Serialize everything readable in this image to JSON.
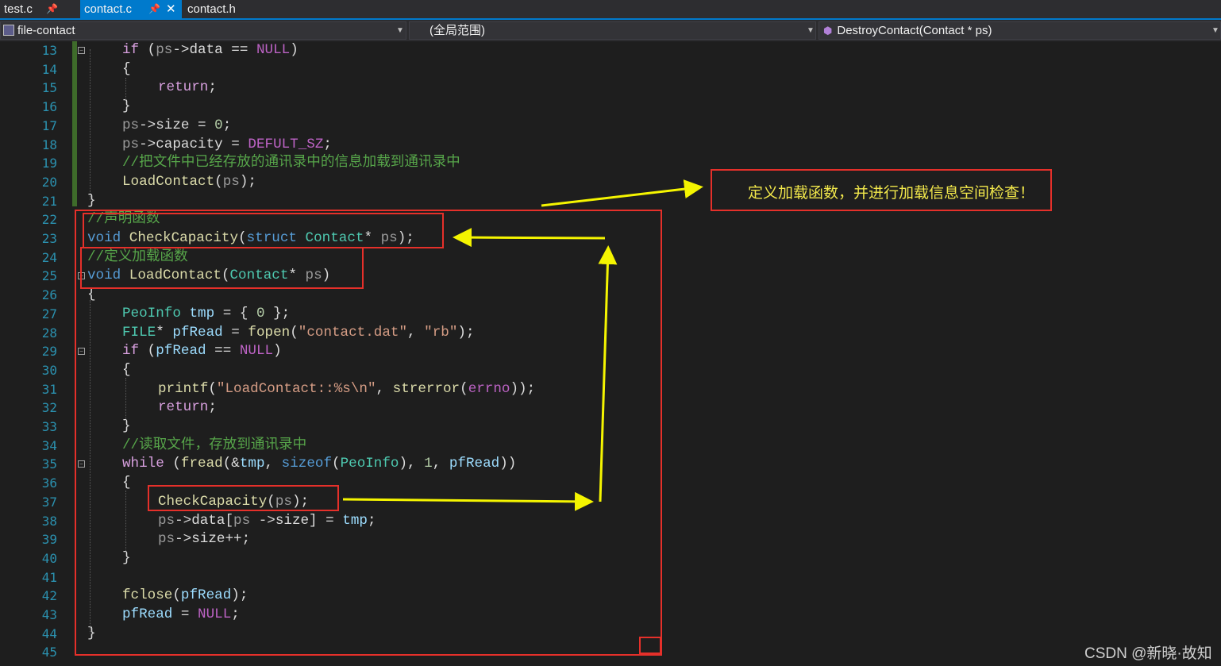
{
  "tabs": [
    {
      "label": "test.c",
      "pin": "pin-icon"
    },
    {
      "label": "contact.c",
      "pin": "pin-icon",
      "close": "close-icon",
      "active": true
    },
    {
      "label": "contact.h"
    }
  ],
  "nav": {
    "project": "file-contact",
    "scope": "(全局范围)",
    "member": "DestroyContact(Contact * ps)"
  },
  "code_lines": [
    {
      "n": "13"
    },
    {
      "n": "14"
    },
    {
      "n": "15"
    },
    {
      "n": "16"
    },
    {
      "n": "17"
    },
    {
      "n": "18"
    },
    {
      "n": "19"
    },
    {
      "n": "20"
    },
    {
      "n": "21"
    },
    {
      "n": "22"
    },
    {
      "n": "23"
    },
    {
      "n": "24"
    },
    {
      "n": "25"
    },
    {
      "n": "26"
    },
    {
      "n": "27"
    },
    {
      "n": "28"
    },
    {
      "n": "29"
    },
    {
      "n": "30"
    },
    {
      "n": "31"
    },
    {
      "n": "32"
    },
    {
      "n": "33"
    },
    {
      "n": "34"
    },
    {
      "n": "35"
    },
    {
      "n": "36"
    },
    {
      "n": "37"
    },
    {
      "n": "38"
    },
    {
      "n": "39"
    },
    {
      "n": "40"
    },
    {
      "n": "41"
    },
    {
      "n": "42"
    },
    {
      "n": "43"
    },
    {
      "n": "44"
    },
    {
      "n": "45"
    }
  ],
  "code": {
    "l13": {
      "if": "if",
      "a": " (",
      "ps": "ps",
      "b": "->data == ",
      "null": "NULL",
      "c": ")"
    },
    "l14": "{",
    "l15": {
      "ret": "return",
      "semi": ";"
    },
    "l16": "}",
    "l17": {
      "ps": "ps",
      "a": "->size = ",
      "num": "0",
      "b": ";"
    },
    "l18": {
      "ps": "ps",
      "a": "->capacity = ",
      "mac": "DEFULT_SZ",
      "b": ";"
    },
    "l19": "//把文件中已经存放的通讯录中的信息加载到通讯录中",
    "l20": {
      "fn": "LoadContact",
      "a": "(",
      "ps": "ps",
      "b": ");"
    },
    "l21": "}",
    "l22": "//声明函数",
    "l23": {
      "void": "void",
      "fn": "CheckCapacity",
      "a": "(",
      "struct": "struct",
      "ty": "Contact",
      "b": "* ",
      "ps": "ps",
      "c": ");"
    },
    "l24": "//定义加载函数",
    "l25": {
      "void": "void",
      "fn": "LoadContact",
      "a": "(",
      "ty": "Contact",
      "b": "* ",
      "ps": "ps",
      "c": ")"
    },
    "l26": "{",
    "l27": {
      "ty": "PeoInfo",
      "var": "tmp",
      "a": " = { ",
      "num": "0",
      "b": " };"
    },
    "l28": {
      "ty": "FILE",
      "a": "* ",
      "var": "pfRead",
      "b": " = ",
      "fn": "fopen",
      "c": "(",
      "s1": "\"contact.dat\"",
      "d": ", ",
      "s2": "\"rb\"",
      "e": ");"
    },
    "l29": {
      "if": "if",
      "a": " (",
      "var": "pfRead",
      "b": " == ",
      "null": "NULL",
      "c": ")"
    },
    "l30": "{",
    "l31": {
      "fn": "printf",
      "a": "(",
      "s1": "\"LoadContact::%s\\n\"",
      "b": ", ",
      "fn2": "strerror",
      "c": "(",
      "mac": "errno",
      "d": "));"
    },
    "l32": {
      "ret": "return",
      "semi": ";"
    },
    "l33": "}",
    "l34": "//读取文件，存放到通讯录中",
    "l35": {
      "while": "while",
      "a": " (",
      "fn": "fread",
      "b": "(&",
      "var": "tmp",
      "c": ", ",
      "kw": "sizeof",
      "d": "(",
      "ty": "PeoInfo",
      "e": "), ",
      "num": "1",
      "f": ", ",
      "var2": "pfRead",
      "g": "))"
    },
    "l36": "{",
    "l37": {
      "fn": "CheckCapacity",
      "a": "(",
      "ps": "ps",
      "b": ");"
    },
    "l38": {
      "ps": "ps",
      "a": "->data[",
      "ps2": "ps",
      "b": " ->size] = ",
      "var": "tmp",
      "c": ";"
    },
    "l39": {
      "ps": "ps",
      "a": "->size++;"
    },
    "l40": "}",
    "l41": "",
    "l42": {
      "fn": "fclose",
      "a": "(",
      "var": "pfRead",
      "b": ");"
    },
    "l43": {
      "var": "pfRead",
      "a": " = ",
      "null": "NULL",
      "b": ";"
    },
    "l44": "}",
    "l45": ""
  },
  "annotation": {
    "note": "定义加载函数，并进行加载信息空间检查！",
    "box_color": "#e5302a",
    "arrow_color": "#f5f500"
  },
  "watermark": "CSDN @新晓·故知",
  "colors": {
    "keyword": "#569cd6",
    "control": "#d8a0df",
    "type": "#4ec9b0",
    "function": "#dcdcaa",
    "string": "#d69d85",
    "comment": "#57a64a",
    "line_number": "#2b91af"
  }
}
